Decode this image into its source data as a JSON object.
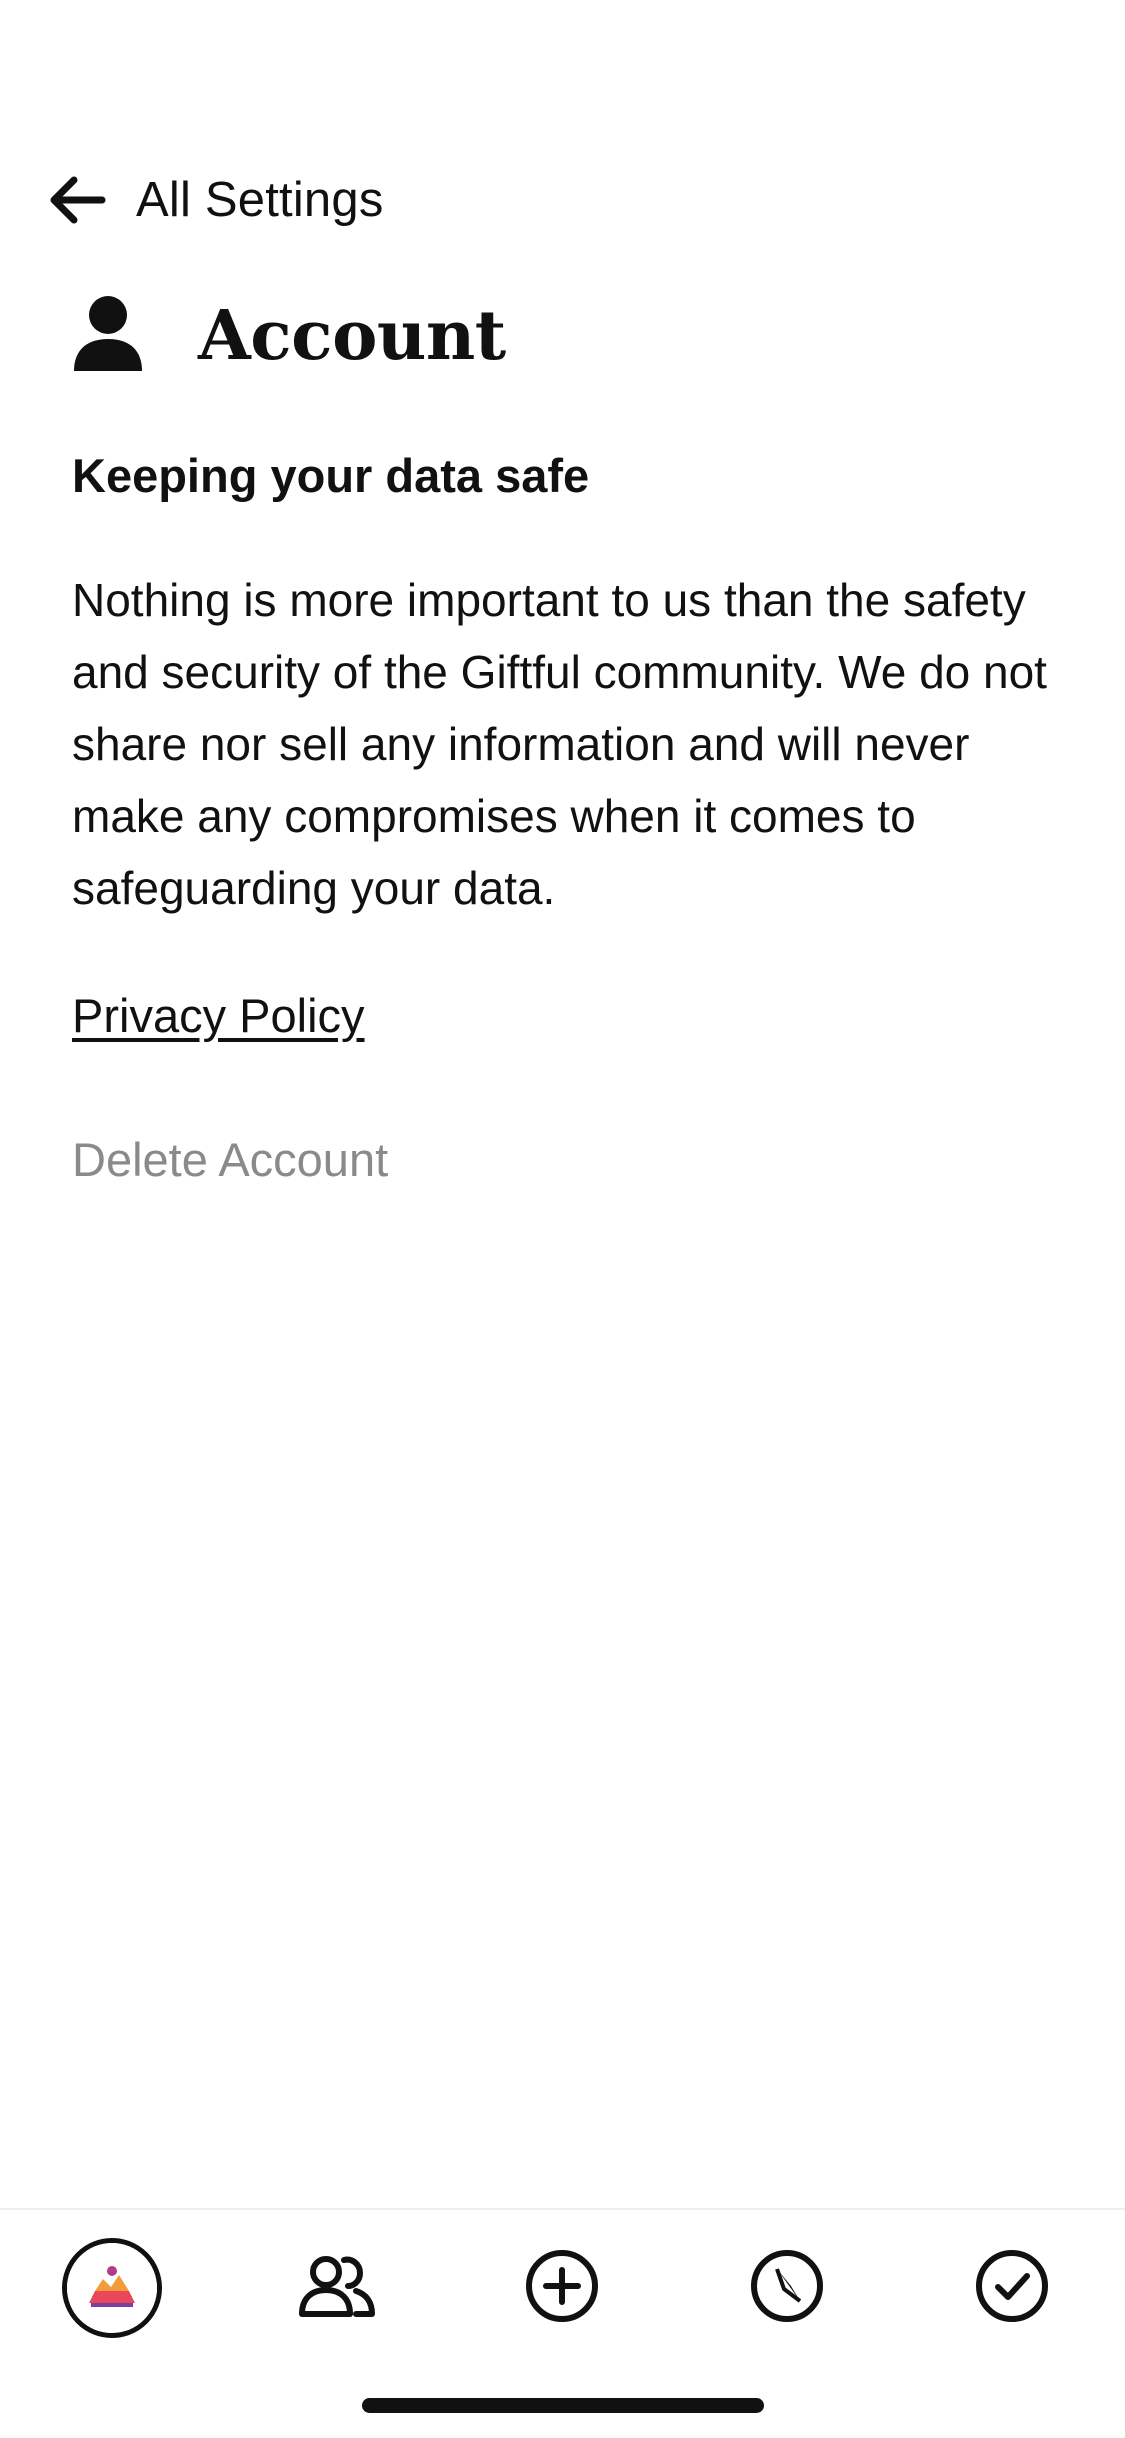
{
  "nav": {
    "back_label": "All Settings",
    "back_icon": "arrow-left-icon"
  },
  "header": {
    "icon": "person-icon",
    "title": "Account"
  },
  "content": {
    "heading": "Keeping your data safe",
    "body": "Nothing is more important to us than the safety and security of the Giftful community. We do not share nor sell any information and will never make any compromises when it comes to safeguarding your data.",
    "privacy_link": "Privacy Policy",
    "delete_label": "Delete Account"
  },
  "tab_bar": {
    "items": [
      {
        "icon": "profile-avatar-icon"
      },
      {
        "icon": "people-icon"
      },
      {
        "icon": "add-circle-icon"
      },
      {
        "icon": "compass-icon"
      },
      {
        "icon": "check-circle-icon"
      }
    ]
  },
  "colors": {
    "text": "#111111",
    "muted": "#8a8a8a",
    "background": "#ffffff",
    "divider": "#eeeeee"
  }
}
